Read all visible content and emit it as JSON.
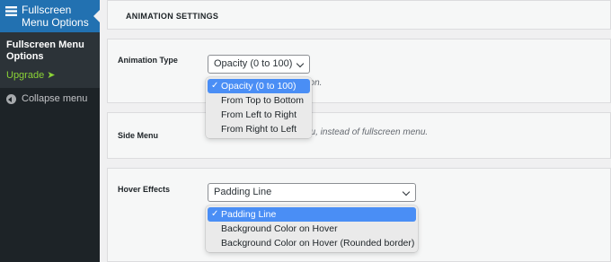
{
  "sidebar": {
    "menu_title": "Fullscreen Menu Options",
    "submenu": {
      "current": "Fullscreen Menu Options",
      "upgrade": "Upgrade ➤"
    },
    "collapse": "Collapse menu"
  },
  "main": {
    "section_heading": "ANIMATION SETTINGS",
    "animation": {
      "label": "Animation Type",
      "value": "Opacity (0 to 100)",
      "description_visible": "ation.",
      "options": [
        "Opacity (0 to 100)",
        "From Top to Bottom",
        "From Left to Right",
        "From Right to Left"
      ],
      "selected_index": 0
    },
    "side_menu": {
      "label": "Side Menu",
      "description_visible": "nu, instead of fullscreen menu."
    },
    "hover": {
      "label": "Hover Effects",
      "value": "Padding Line",
      "options": [
        "Padding Line",
        "Background Color on Hover",
        "Background Color on Hover (Rounded border)"
      ],
      "selected_index": 0
    }
  },
  "icons": {
    "check": "✓"
  },
  "colors": {
    "admin_bar_bg": "#1d2327",
    "active_menu": "#2271b1",
    "upgrade_text": "#8bd336",
    "selected_option": "#4a8ef5"
  }
}
